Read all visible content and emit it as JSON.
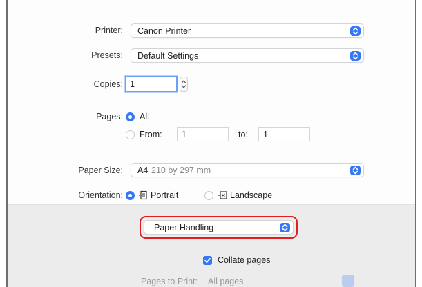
{
  "printer": {
    "label": "Printer:",
    "value": "Canon Printer"
  },
  "presets": {
    "label": "Presets:",
    "value": "Default Settings"
  },
  "copies": {
    "label": "Copies:",
    "value": "1"
  },
  "pages": {
    "label": "Pages:",
    "all_label": "All",
    "from_label": "From:",
    "from_value": "1",
    "to_label": "to:",
    "to_value": "1"
  },
  "paper_size": {
    "label": "Paper Size:",
    "value_bold": "A4",
    "value_detail": "210 by 297 mm"
  },
  "orientation": {
    "label": "Orientation:",
    "portrait_label": "Portrait",
    "landscape_label": "Landscape",
    "selected": "Portrait"
  },
  "section_popup": {
    "value": "Paper Handling"
  },
  "collate": {
    "label": "Collate pages",
    "checked": true
  },
  "pages_to_print": {
    "label": "Pages to Print:",
    "value": "All pages"
  },
  "colors": {
    "accent": "#3478f6",
    "highlight": "#e02020"
  }
}
